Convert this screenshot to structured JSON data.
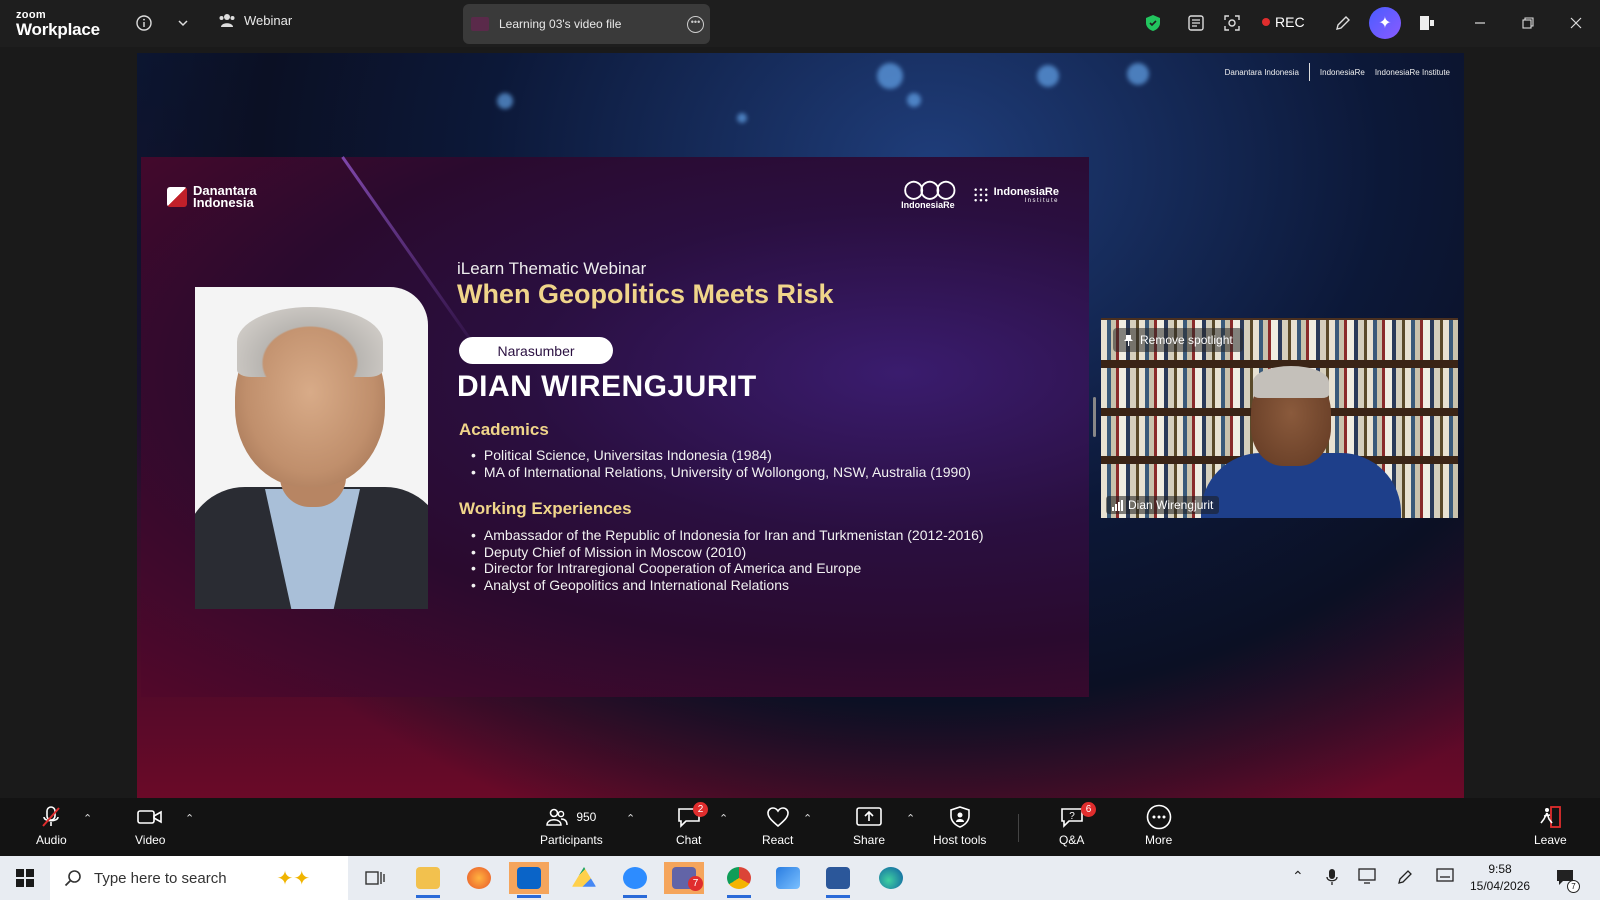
{
  "app": {
    "brand_small": "zoom",
    "brand_large": "Workplace"
  },
  "titlebar": {
    "meeting_type": "Webinar",
    "share_tab": "Learning 03's video file",
    "rec_label": "REC"
  },
  "slide": {
    "top_logos": [
      "Danantara Indonesia",
      "IndonesiaRe",
      "IndonesiaRe Institute"
    ],
    "org_logo": "Danantara Indonesia",
    "logo_ire": "IndonesiaRe",
    "logo_ire_inst": "IndonesiaRe",
    "logo_ire_inst_sub": "Institute",
    "kicker": "iLearn Thematic Webinar",
    "title": "When Geopolitics Meets Risk",
    "badge": "Narasumber",
    "speaker": "DIAN WIRENGJURIT",
    "sec_academics": "Academics",
    "academics": [
      "Political Science, Universitas Indonesia (1984)",
      "MA of International Relations, University of Wollongong, NSW, Australia (1990)"
    ],
    "sec_work": "Working Experiences",
    "work": [
      "Ambassador of the Republic of Indonesia for Iran and Turkmenistan (2012-2016)",
      "Deputy Chief of Mission in Moscow (2010)",
      "Director for Intraregional Cooperation of America and Europe",
      "Analyst of Geopolitics and International Relations"
    ]
  },
  "spotlight": {
    "button": "Remove spotlight",
    "name": "Dian Wirengjurit"
  },
  "toolbar": {
    "audio": "Audio",
    "video": "Video",
    "participants": "Participants",
    "participants_count": "950",
    "chat": "Chat",
    "chat_badge": "2",
    "react": "React",
    "share": "Share",
    "host_tools": "Host tools",
    "qa": "Q&A",
    "qa_badge": "6",
    "more": "More",
    "leave": "Leave"
  },
  "taskbar": {
    "search_placeholder": "Type here to search",
    "time": "9:58",
    "date": "15/04/2026",
    "teams_badge": "7",
    "notif_badge": "7"
  },
  "colors": {
    "accent_gold": "#f0d58a",
    "rec_red": "#e02d2d",
    "shield_green": "#22c55e"
  }
}
